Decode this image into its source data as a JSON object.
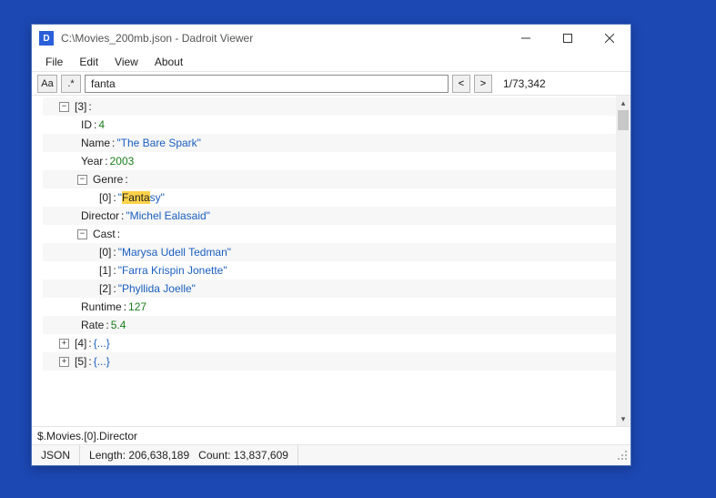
{
  "titlebar": {
    "filepath": "C:\\Movies_200mb.json",
    "appname": "Dadroit Viewer",
    "separator": " - "
  },
  "menubar": {
    "items": [
      "File",
      "Edit",
      "View",
      "About"
    ]
  },
  "toolbar": {
    "case_sensitive_label": "Aa",
    "regex_label": ".*",
    "search_value": "fanta",
    "prev_label": "<",
    "next_label": ">",
    "result_counter": "1/73,342"
  },
  "tree": {
    "rows": [
      {
        "indent": 1,
        "expander": "minus",
        "key": "[3]",
        "value_type": "none",
        "value": ""
      },
      {
        "indent": 2,
        "expander": "none",
        "key": "ID",
        "value_type": "num",
        "value": "4"
      },
      {
        "indent": 2,
        "expander": "none",
        "key": "Name",
        "value_type": "str",
        "value": "The Bare Spark"
      },
      {
        "indent": 2,
        "expander": "none",
        "key": "Year",
        "value_type": "num",
        "value": "2003"
      },
      {
        "indent": 2,
        "expander": "minus",
        "key": "Genre",
        "value_type": "none",
        "value": ""
      },
      {
        "indent": 3,
        "expander": "none",
        "key": "[0]",
        "value_type": "str-hl",
        "value_pre": "",
        "value_hl": "Fanta",
        "value_post": "sy"
      },
      {
        "indent": 2,
        "expander": "none",
        "key": "Director",
        "value_type": "str",
        "value": "Michel Ealasaid"
      },
      {
        "indent": 2,
        "expander": "minus",
        "key": "Cast",
        "value_type": "none",
        "value": ""
      },
      {
        "indent": 3,
        "expander": "none",
        "key": "[0]",
        "value_type": "str",
        "value": "Marysa Udell Tedman"
      },
      {
        "indent": 3,
        "expander": "none",
        "key": "[1]",
        "value_type": "str",
        "value": "Farra Krispin Jonette"
      },
      {
        "indent": 3,
        "expander": "none",
        "key": "[2]",
        "value_type": "str",
        "value": "Phyllida Joelle"
      },
      {
        "indent": 2,
        "expander": "none",
        "key": "Runtime",
        "value_type": "num",
        "value": "127"
      },
      {
        "indent": 2,
        "expander": "none",
        "key": "Rate",
        "value_type": "num",
        "value": "5.4"
      },
      {
        "indent": 1,
        "expander": "plus",
        "key": "[4]",
        "value_type": "braces",
        "value": "{...}"
      },
      {
        "indent": 1,
        "expander": "plus",
        "key": "[5]",
        "value_type": "braces",
        "value": "{...}"
      }
    ]
  },
  "pathbar": {
    "path": "$.Movies.[0].Director"
  },
  "statusbar": {
    "type": "JSON",
    "length_label": "Length:",
    "length_value": "206,638,189",
    "count_label": "Count:",
    "count_value": "13,837,609"
  }
}
